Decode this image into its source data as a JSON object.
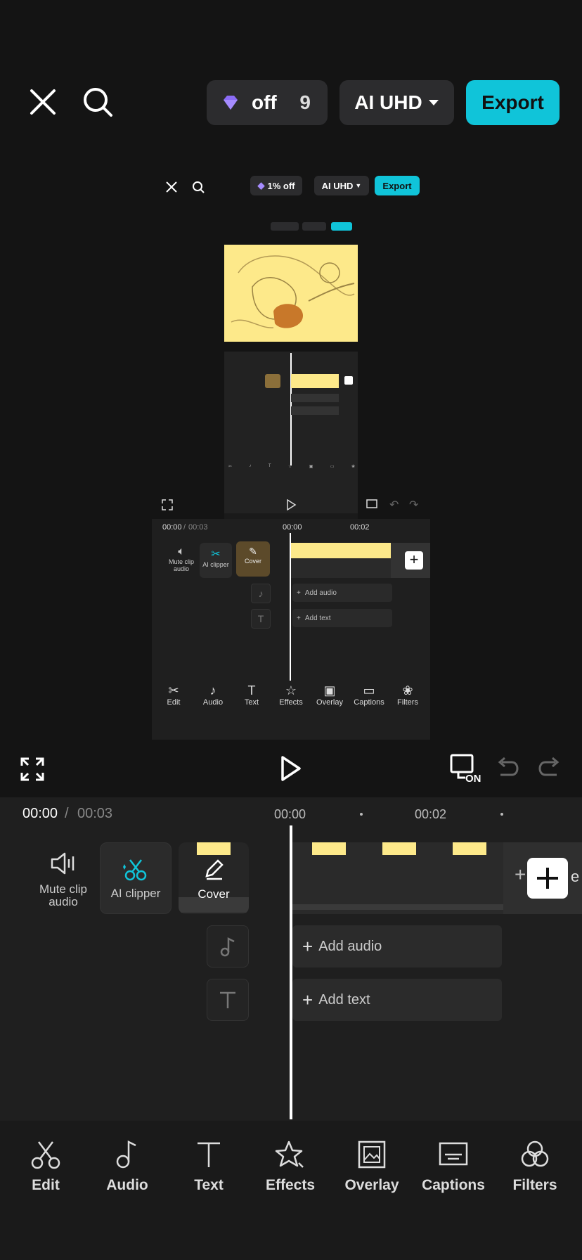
{
  "topbar": {
    "pro_discount": "off",
    "pro_count": "9",
    "resolution": "AI UHD",
    "export_label": "Export"
  },
  "preview_mini": {
    "pro_discount": "1% off",
    "resolution": "AI UHD",
    "export_label": "Export",
    "time_current": "00:00",
    "time_total": "00:03",
    "ruler": [
      "00:00",
      "00:02"
    ],
    "side": [
      "Mute clip audio",
      "AI clipper",
      "Cover"
    ],
    "add_audio": "Add audio",
    "add_text": "Add text",
    "tools": [
      "Edit",
      "Audio",
      "Text",
      "Effects",
      "Overlay",
      "Captions",
      "Filters"
    ]
  },
  "timeline": {
    "time_current": "00:00",
    "time_separator": "/",
    "time_total": "00:03",
    "ruler": [
      "00:00",
      "00:02"
    ],
    "mute_label": "Mute clip audio",
    "ai_clipper_label": "AI clipper",
    "cover_label": "Cover",
    "add_audio": "Add audio",
    "add_text": "Add text",
    "add_clip_partial": "e"
  },
  "toolbar": {
    "items": [
      {
        "label": "Edit",
        "icon": "scissors-icon"
      },
      {
        "label": "Audio",
        "icon": "music-note-icon"
      },
      {
        "label": "Text",
        "icon": "text-icon"
      },
      {
        "label": "Effects",
        "icon": "star-icon"
      },
      {
        "label": "Overlay",
        "icon": "overlay-icon"
      },
      {
        "label": "Captions",
        "icon": "captions-icon"
      },
      {
        "label": "Filters",
        "icon": "filters-icon"
      }
    ]
  },
  "colors": {
    "accent": "#10c4d9",
    "background": "#141414",
    "panel": "#1f1f1f",
    "gem": "#8b6cf6"
  }
}
